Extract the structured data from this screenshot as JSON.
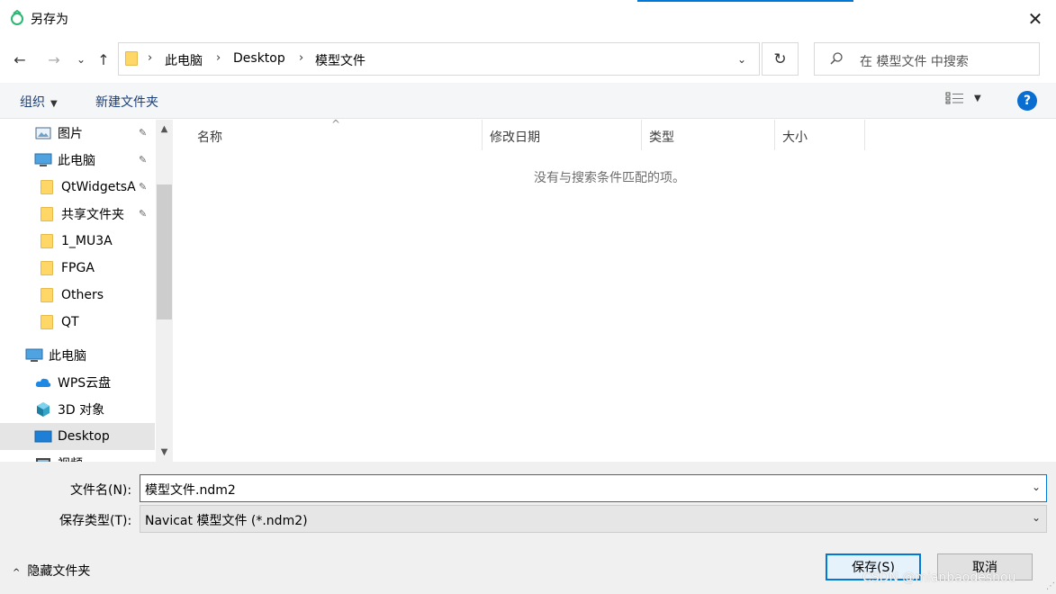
{
  "window": {
    "title": "另存为",
    "close_glyph": "✕"
  },
  "nav": {
    "back_glyph": "←",
    "forward_glyph": "→",
    "recent_glyph": "⌄",
    "up_glyph": "↑",
    "breadcrumbs": [
      "此电脑",
      "Desktop",
      "模型文件"
    ],
    "sep": "›",
    "dropdown_glyph": "⌄",
    "refresh_glyph": "↻",
    "search_placeholder": "在 模型文件 中搜索"
  },
  "toolbar": {
    "organize": "组织",
    "new_folder": "新建文件夹"
  },
  "sidebar": {
    "items": [
      {
        "label": "图片",
        "icon": "pictures-icon",
        "pinned": true
      },
      {
        "label": "此电脑",
        "icon": "computer-icon",
        "pinned": true
      },
      {
        "label": "QtWidgetsA",
        "icon": "folder-icon",
        "pinned": true
      },
      {
        "label": "共享文件夹",
        "icon": "folder-icon",
        "pinned": true
      },
      {
        "label": "1_MU3A",
        "icon": "folder-icon",
        "pinned": false
      },
      {
        "label": "FPGA",
        "icon": "folder-icon",
        "pinned": false
      },
      {
        "label": "Others",
        "icon": "folder-icon",
        "pinned": false
      },
      {
        "label": "QT",
        "icon": "folder-icon",
        "pinned": false
      },
      {
        "label": "此电脑",
        "icon": "computer-icon",
        "pinned": false
      },
      {
        "label": "WPS云盘",
        "icon": "cloud-icon",
        "pinned": false
      },
      {
        "label": "3D 对象",
        "icon": "3d-objects-icon",
        "pinned": false
      },
      {
        "label": "Desktop",
        "icon": "desktop-icon",
        "pinned": false
      },
      {
        "label": "视频",
        "icon": "videos-icon",
        "pinned": false
      }
    ],
    "pin_glyph": "📌"
  },
  "columns": [
    "名称",
    "修改日期",
    "类型",
    "大小"
  ],
  "empty_message": "没有与搜索条件匹配的项。",
  "form": {
    "filename_label": "文件名(N):",
    "filename_value": "模型文件.ndm2",
    "filetype_label": "保存类型(T):",
    "filetype_value": "Navicat 模型文件 (*.ndm2)"
  },
  "footer": {
    "hide_folders": "隐藏文件夹",
    "save": "保存(S)",
    "cancel": "取消",
    "watermark": "CSDN @mianbaodeshou"
  },
  "colors": {
    "accent": "#0078d7",
    "folder": "#ffd766",
    "toolbar_bg": "#f5f6f7",
    "bottom_bg": "#f0f0f0"
  }
}
